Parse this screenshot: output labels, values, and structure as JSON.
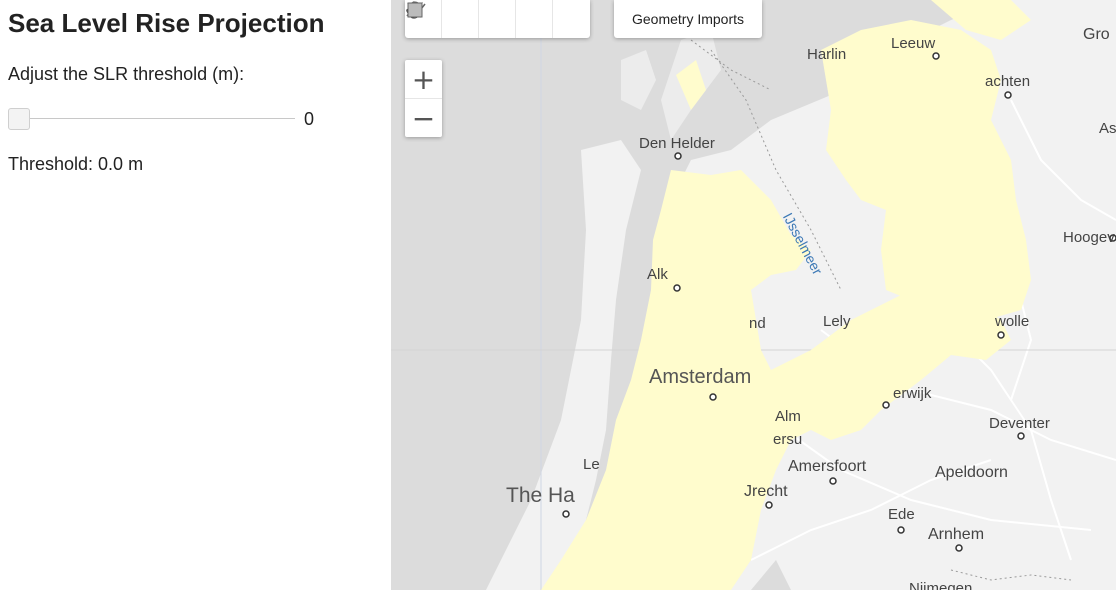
{
  "panel": {
    "title": "Sea Level Rise Projection",
    "slider_label": "Adjust the SLR threshold (m):",
    "slider_value": 0,
    "slider_display": "0",
    "threshold_text": "Threshold: 0.0 m"
  },
  "map": {
    "toolbar": {
      "tools": [
        {
          "name": "pan",
          "icon": "hand-icon"
        },
        {
          "name": "point",
          "icon": "marker-icon"
        },
        {
          "name": "line",
          "icon": "line-icon"
        },
        {
          "name": "polygon",
          "icon": "polygon-icon"
        },
        {
          "name": "rectangle",
          "icon": "rectangle-icon"
        }
      ],
      "geometry_imports": "Geometry Imports"
    },
    "zoom": {
      "in": "+",
      "out": "−"
    },
    "colors": {
      "water": "#dcdcdc",
      "land": "#f2f2f2",
      "flood": "#fffccd",
      "lake_label": "#3b78b5"
    },
    "labels": {
      "harlingen": "Harlin",
      "leeuwarden": "Leeuw",
      "groningen": "Gro",
      "drachten": "achten",
      "assen": "As",
      "den_helder": "Den Helder",
      "ijsselmeer": "IJsselmeer",
      "hoogeveen": "Hoogev",
      "alkmaar": "Alk",
      "lelystad": "Lely",
      "zwolle": "wolle",
      "hoorn_edge": "nd",
      "amsterdam": "Amsterdam",
      "harderwijk": "erwijk",
      "almere": "Alm",
      "hilversum": "ersu",
      "deventer": "Deventer",
      "leiden": "Le",
      "amersfoort": "Amersfoort",
      "apeldoorn": "Apeldoorn",
      "the_hague": "The Ha",
      "utrecht": "Jrecht",
      "ede": "Ede",
      "arnhem": "Arnhem",
      "nijmegen": "Nijmegen",
      "en": "en"
    }
  }
}
